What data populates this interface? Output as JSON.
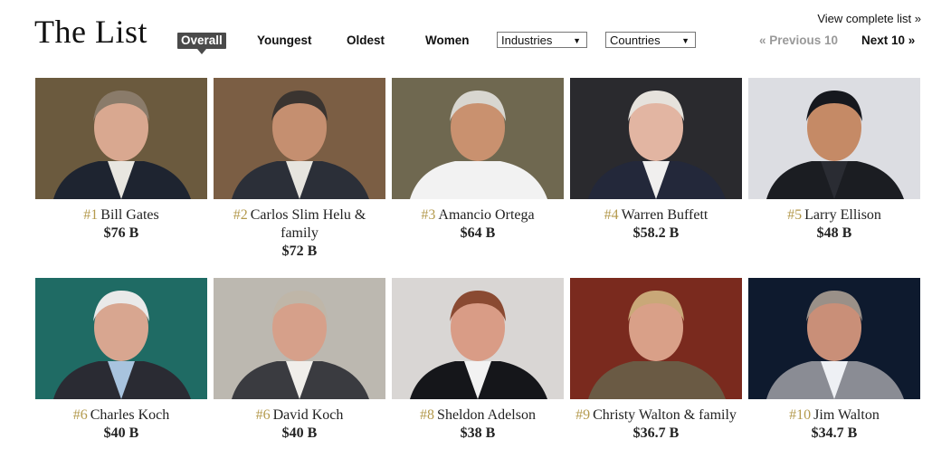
{
  "page": {
    "title": "The List",
    "view_complete": "View complete list »",
    "prev_label": "« Previous 10",
    "next_label": "Next 10 »"
  },
  "tabs": [
    {
      "label": "Overall",
      "active": true
    },
    {
      "label": "Youngest",
      "active": false
    },
    {
      "label": "Oldest",
      "active": false
    },
    {
      "label": "Women",
      "active": false
    }
  ],
  "filters": {
    "industries": "Industries",
    "countries": "Countries"
  },
  "people": [
    {
      "rank": "#1",
      "name": "Bill Gates",
      "worth": "$76 B",
      "bg": "#6b5a3e",
      "suit": "#1e2430",
      "skin": "#d9a890",
      "hair": "#8a7b6a",
      "shirt": "#e8e6e0"
    },
    {
      "rank": "#2",
      "name": "Carlos Slim Helu & family",
      "worth": "$72 B",
      "bg": "#7b5e44",
      "suit": "#2b2f38",
      "skin": "#c58f70",
      "hair": "#3a3430",
      "shirt": "#e6e4de"
    },
    {
      "rank": "#3",
      "name": "Amancio Ortega",
      "worth": "$64 B",
      "bg": "#6f6850",
      "suit": "#f2f2f2",
      "skin": "#c9916f",
      "hair": "#d8d6d0",
      "shirt": "#f2f2f2"
    },
    {
      "rank": "#4",
      "name": "Warren Buffett",
      "worth": "$58.2 B",
      "bg": "#2a2a2e",
      "suit": "#23283a",
      "skin": "#e2b5a2",
      "hair": "#e6e2dc",
      "shirt": "#f0efee"
    },
    {
      "rank": "#5",
      "name": "Larry Ellison",
      "worth": "$48 B",
      "bg": "#dcdde2",
      "suit": "#1b1d22",
      "skin": "#c58a66",
      "hair": "#16181e",
      "shirt": "#2a2c33"
    },
    {
      "rank": "#6",
      "name": "Charles Koch",
      "worth": "$40 B",
      "bg": "#1f6b64",
      "suit": "#2a2b33",
      "skin": "#d8a690",
      "hair": "#e9e9e9",
      "shirt": "#a8c3de"
    },
    {
      "rank": "#6",
      "name": "David Koch",
      "worth": "$40 B",
      "bg": "#bcb8b0",
      "suit": "#3a3b40",
      "skin": "#d6a08a",
      "hair": "#bfb6a8",
      "shirt": "#f0eeea"
    },
    {
      "rank": "#8",
      "name": "Sheldon Adelson",
      "worth": "$38 B",
      "bg": "#d9d6d4",
      "suit": "#15161a",
      "skin": "#d99c86",
      "hair": "#8a4a32",
      "shirt": "#f2f2f2"
    },
    {
      "rank": "#9",
      "name": "Christy Walton & family",
      "worth": "$36.7 B",
      "bg": "#7a2a1e",
      "suit": "#6a5a44",
      "skin": "#d9a088",
      "hair": "#c9a878",
      "shirt": "#6a5a44"
    },
    {
      "rank": "#10",
      "name": "Jim Walton",
      "worth": "$34.7 B",
      "bg": "#0e1a2e",
      "suit": "#8a8c94",
      "skin": "#c98f78",
      "hair": "#9a9088",
      "shirt": "#eef0f4"
    }
  ]
}
